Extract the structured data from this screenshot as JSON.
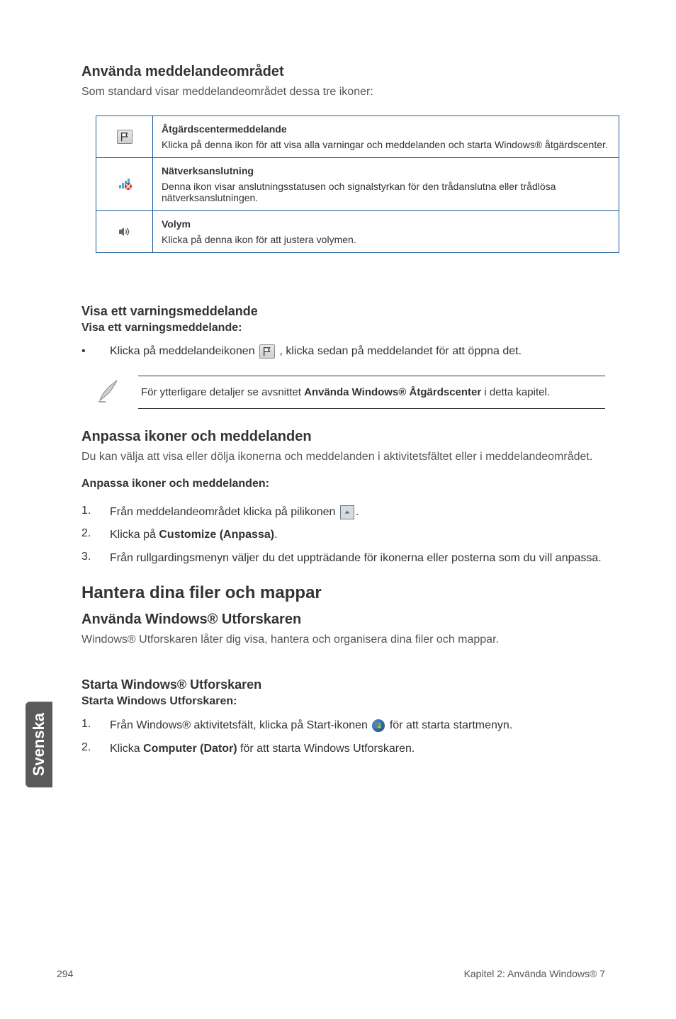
{
  "sidebar": {
    "language": "Svenska"
  },
  "section1": {
    "title": "Använda meddelandeområdet",
    "intro": "Som standard visar meddelandeområdet dessa tre ikoner:",
    "rows": [
      {
        "heading": "Åtgärdscentermeddelande",
        "text": "Klicka på denna ikon för att visa alla varningar och meddelanden och starta Windows® åtgärdscenter."
      },
      {
        "heading": "Nätverksanslutning",
        "text": "Denna ikon visar anslutningsstatusen och signalstyrkan för den trådanslutna eller trådlösa nätverksanslutningen."
      },
      {
        "heading": "Volym",
        "text": "Klicka på denna ikon för att justera volymen."
      }
    ]
  },
  "section2": {
    "title": "Visa ett varningsmeddelande",
    "subtitle": "Visa ett varningsmeddelande:",
    "bullet_before": "Klicka på meddelandeikonen ",
    "bullet_after": ", klicka sedan på meddelandet för att öppna det.",
    "note_before": "För ytterligare detaljer se avsnittet ",
    "note_bold": "Använda Windows® Åtgärdscenter",
    "note_after": " i detta kapitel."
  },
  "section3": {
    "title": "Anpassa ikoner och meddelanden",
    "intro": "Du kan välja att visa eller dölja ikonerna och meddelanden i aktivitetsfältet eller i meddelandeområdet.",
    "subtitle": "Anpassa ikoner och meddelanden:",
    "steps": [
      {
        "num": "1.",
        "before": "Från meddelandeområdet klicka på pilikonen ",
        "after": "."
      },
      {
        "num": "2.",
        "before": "Klicka på ",
        "bold": "Customize (Anpassa)",
        "after": "."
      },
      {
        "num": "3.",
        "text": "Från rullgardingsmenyn väljer du det uppträdande för ikonerna eller posterna som du vill anpassa."
      }
    ]
  },
  "main2": {
    "title": "Hantera dina filer och mappar",
    "sub1": {
      "title": "Använda Windows® Utforskaren",
      "intro": "Windows® Utforskaren låter dig visa, hantera och organisera dina filer och mappar."
    },
    "sub2": {
      "title": "Starta Windows® Utforskaren",
      "subtitle": "Starta Windows Utforskaren:",
      "steps": [
        {
          "num": "1.",
          "before": "Från Windows® aktivitetsfält, klicka på Start-ikonen ",
          "after": " för att starta startmenyn."
        },
        {
          "num": "2.",
          "before": "Klicka ",
          "bold": "Computer (Dator)",
          "after": " för att starta Windows Utforskaren."
        }
      ]
    }
  },
  "footer": {
    "page": "294",
    "chapter": "Kapitel 2: Använda Windows® 7"
  }
}
